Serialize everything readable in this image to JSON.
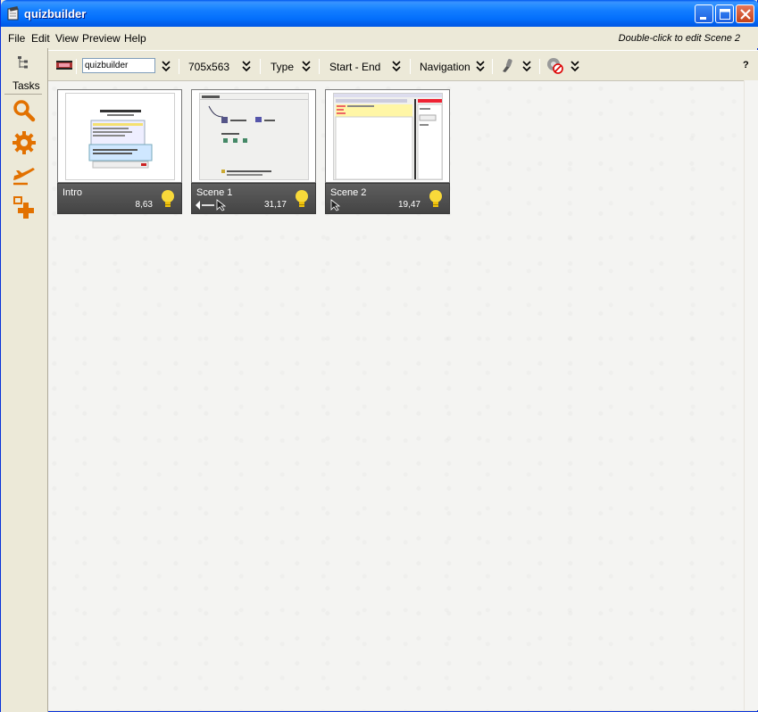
{
  "window": {
    "title": "quizbuilder"
  },
  "menubar": {
    "items": [
      "File",
      "Edit",
      "View",
      "Preview",
      "Help"
    ],
    "hint": "Double-click to edit Scene 2"
  },
  "toolbar": {
    "project_name": "quizbuilder",
    "size": "705x563",
    "type_label": "Type",
    "timing_label": "Start - End",
    "navigation_label": "Navigation",
    "help": "?"
  },
  "tasks": {
    "label": "Tasks",
    "icons": [
      "search-icon",
      "gear-icon",
      "airplane-icon",
      "add-scene-icon"
    ]
  },
  "scenes": [
    {
      "name": "Intro",
      "duration": "8,63"
    },
    {
      "name": "Scene 1",
      "duration": "31,17"
    },
    {
      "name": "Scene 2",
      "duration": "19,47"
    }
  ],
  "colors": {
    "titlebar": "#0a5ce6",
    "accent": "#e27100",
    "card_info": "#4f4f4f"
  }
}
